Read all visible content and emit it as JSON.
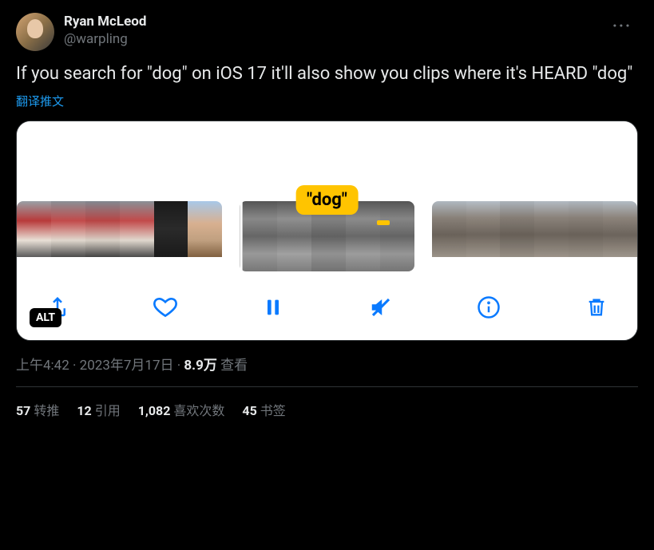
{
  "user": {
    "display_name": "Ryan McLeod",
    "handle": "@warpling"
  },
  "tweet": {
    "text": "If you search for \"dog\" on iOS 17 it'll also show you clips where it's HEARD \"dog\"",
    "translate_label": "翻译推文"
  },
  "media": {
    "bubble_text": "\"dog\"",
    "alt_label": "ALT"
  },
  "meta": {
    "time": "上午4:42",
    "date": "2023年7月17日",
    "views_count": "8.9万",
    "views_label": "查看"
  },
  "stats": {
    "retweets_count": "57",
    "retweets_label": "转推",
    "quotes_count": "12",
    "quotes_label": "引用",
    "likes_count": "1,082",
    "likes_label": "喜欢次数",
    "bookmarks_count": "45",
    "bookmarks_label": "书签"
  }
}
